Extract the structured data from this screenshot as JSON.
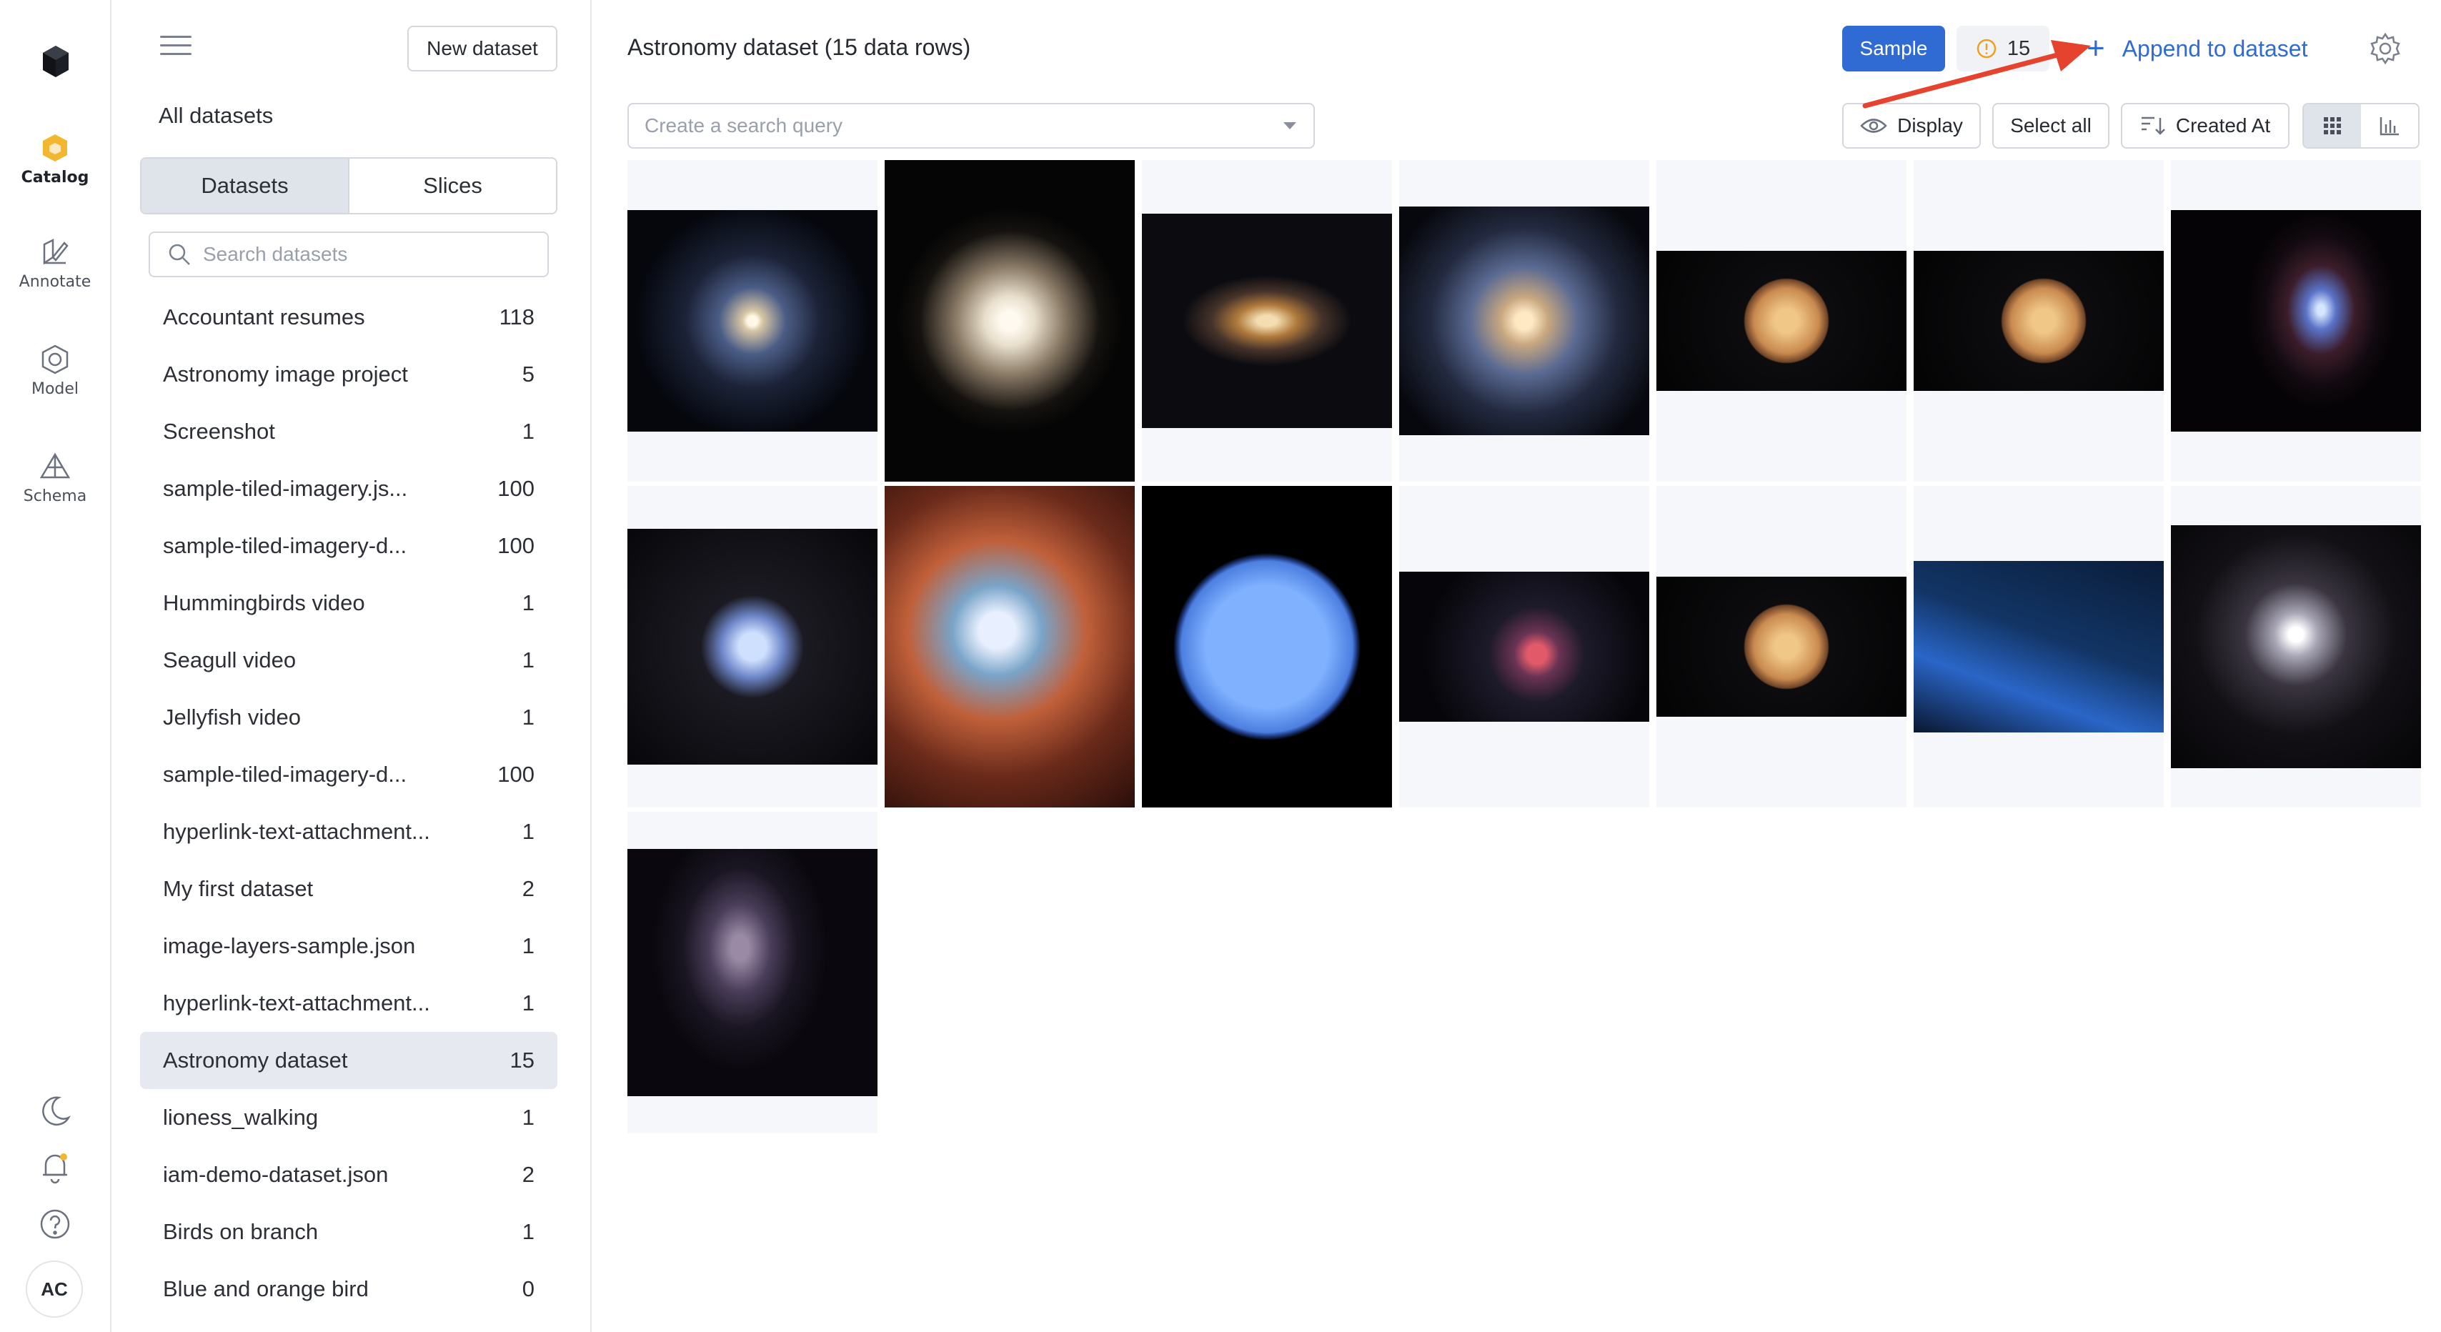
{
  "rail": {
    "items": [
      {
        "label": "Catalog",
        "icon": "catalog-icon",
        "active": true
      },
      {
        "label": "Annotate",
        "icon": "annotate-icon"
      },
      {
        "label": "Model",
        "icon": "model-icon"
      },
      {
        "label": "Schema",
        "icon": "schema-icon"
      }
    ],
    "avatar": "AC",
    "bottom_icons": [
      "moon-icon",
      "bell-icon",
      "help-icon"
    ]
  },
  "sidebar": {
    "new_dataset_label": "New dataset",
    "all_datasets_label": "All datasets",
    "tabs": [
      "Datasets",
      "Slices"
    ],
    "search_placeholder": "Search datasets",
    "datasets": [
      {
        "name": "Accountant resumes",
        "count": "118"
      },
      {
        "name": "Astronomy image project",
        "count": "5"
      },
      {
        "name": "Screenshot",
        "count": "1"
      },
      {
        "name": "sample-tiled-imagery.js...",
        "count": "100"
      },
      {
        "name": "sample-tiled-imagery-d...",
        "count": "100"
      },
      {
        "name": "Hummingbirds video",
        "count": "1"
      },
      {
        "name": "Seagull video",
        "count": "1"
      },
      {
        "name": "Jellyfish video",
        "count": "1"
      },
      {
        "name": "sample-tiled-imagery-d...",
        "count": "100"
      },
      {
        "name": "hyperlink-text-attachment...",
        "count": "1"
      },
      {
        "name": "My first dataset",
        "count": "2"
      },
      {
        "name": "image-layers-sample.json",
        "count": "1"
      },
      {
        "name": "hyperlink-text-attachment...",
        "count": "1"
      },
      {
        "name": "Astronomy dataset",
        "count": "15",
        "selected": true
      },
      {
        "name": "lioness_walking",
        "count": "1"
      },
      {
        "name": "iam-demo-dataset.json",
        "count": "2"
      },
      {
        "name": "Birds on branch",
        "count": "1"
      },
      {
        "name": "Blue and orange bird",
        "count": "0"
      }
    ]
  },
  "main": {
    "title": "Astronomy dataset (15 data rows)",
    "sample_label": "Sample",
    "warning_count": "15",
    "append_label": "Append to dataset",
    "query_placeholder": "Create a search query",
    "display_label": "Display",
    "select_all_label": "Select all",
    "sort_label": "Created At",
    "colors": {
      "accent": "#2f6bd3",
      "arrow": "#e5432d",
      "warning": "#f0a020"
    }
  },
  "gallery": [
    {
      "kind": "spiral-galaxy"
    },
    {
      "kind": "lenticular-galaxy"
    },
    {
      "kind": "tilted-galaxy"
    },
    {
      "kind": "barred-spiral"
    },
    {
      "kind": "planet-venus"
    },
    {
      "kind": "planet-venus"
    },
    {
      "kind": "herbig-haro-jet"
    },
    {
      "kind": "planetary-nebula"
    },
    {
      "kind": "star-cluster-nebula"
    },
    {
      "kind": "neptune"
    },
    {
      "kind": "supernova-remnant"
    },
    {
      "kind": "planet-venus"
    },
    {
      "kind": "comet"
    },
    {
      "kind": "interacting-galaxies"
    },
    {
      "kind": "dust-pillar"
    }
  ]
}
